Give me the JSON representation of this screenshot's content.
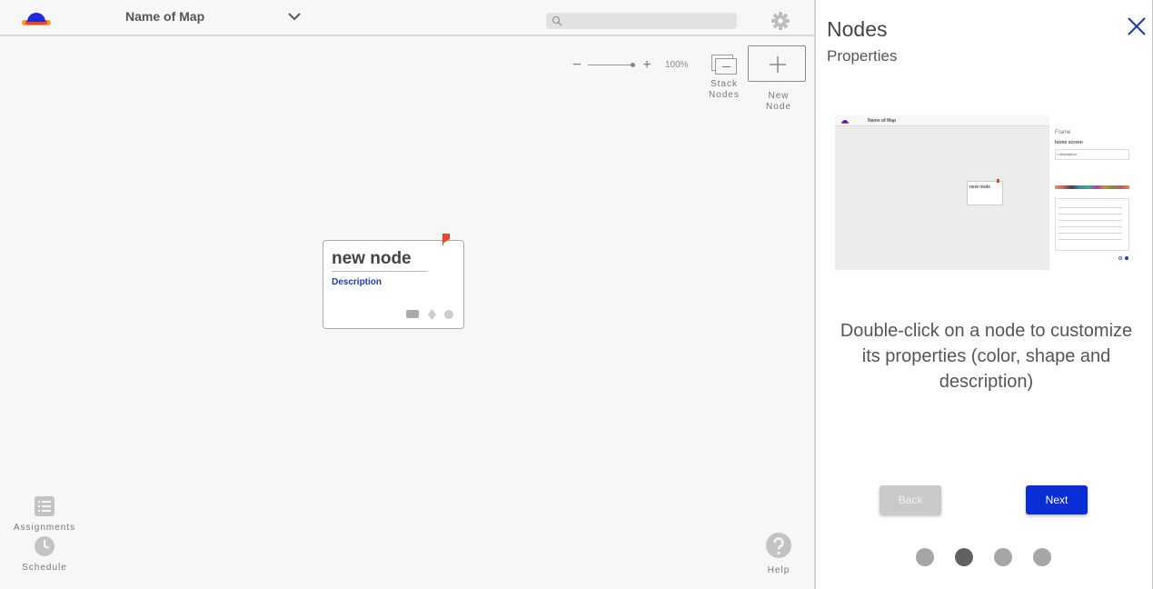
{
  "header": {
    "map_name": "Name of Map",
    "search_placeholder": ""
  },
  "zoom": {
    "level": "100%"
  },
  "toolbar": {
    "stack_nodes_line1": "Stack",
    "stack_nodes_line2": "Nodes",
    "new_node_line1": "New",
    "new_node_line2": "Node"
  },
  "node": {
    "title": "new node",
    "description": "Description"
  },
  "sidebar": {
    "assignments": "Assignments",
    "schedule": "Schedule",
    "help": "Help"
  },
  "panel": {
    "title": "Nodes",
    "subtitle": "Properties",
    "hint": "Double-click on a node to customize its properties (color, shape and description)",
    "back_label": "Back",
    "next_label": "Next",
    "pages": 4,
    "current_page": 2,
    "preview": {
      "map_name": "Name of Map",
      "side_label": "Frame",
      "side_title": "home screen",
      "description": "• description",
      "node_title": "new node"
    }
  },
  "colors": {
    "accent": "#0a2ed6",
    "close_icon": "#1c3aa9",
    "flag": "#e8452c"
  },
  "icons": [
    "logo-icon",
    "chevron-down-icon",
    "search-icon",
    "gear-icon",
    "stack-icon",
    "plus-icon",
    "flag-icon",
    "list-icon",
    "clock-icon",
    "help-icon",
    "close-icon"
  ]
}
